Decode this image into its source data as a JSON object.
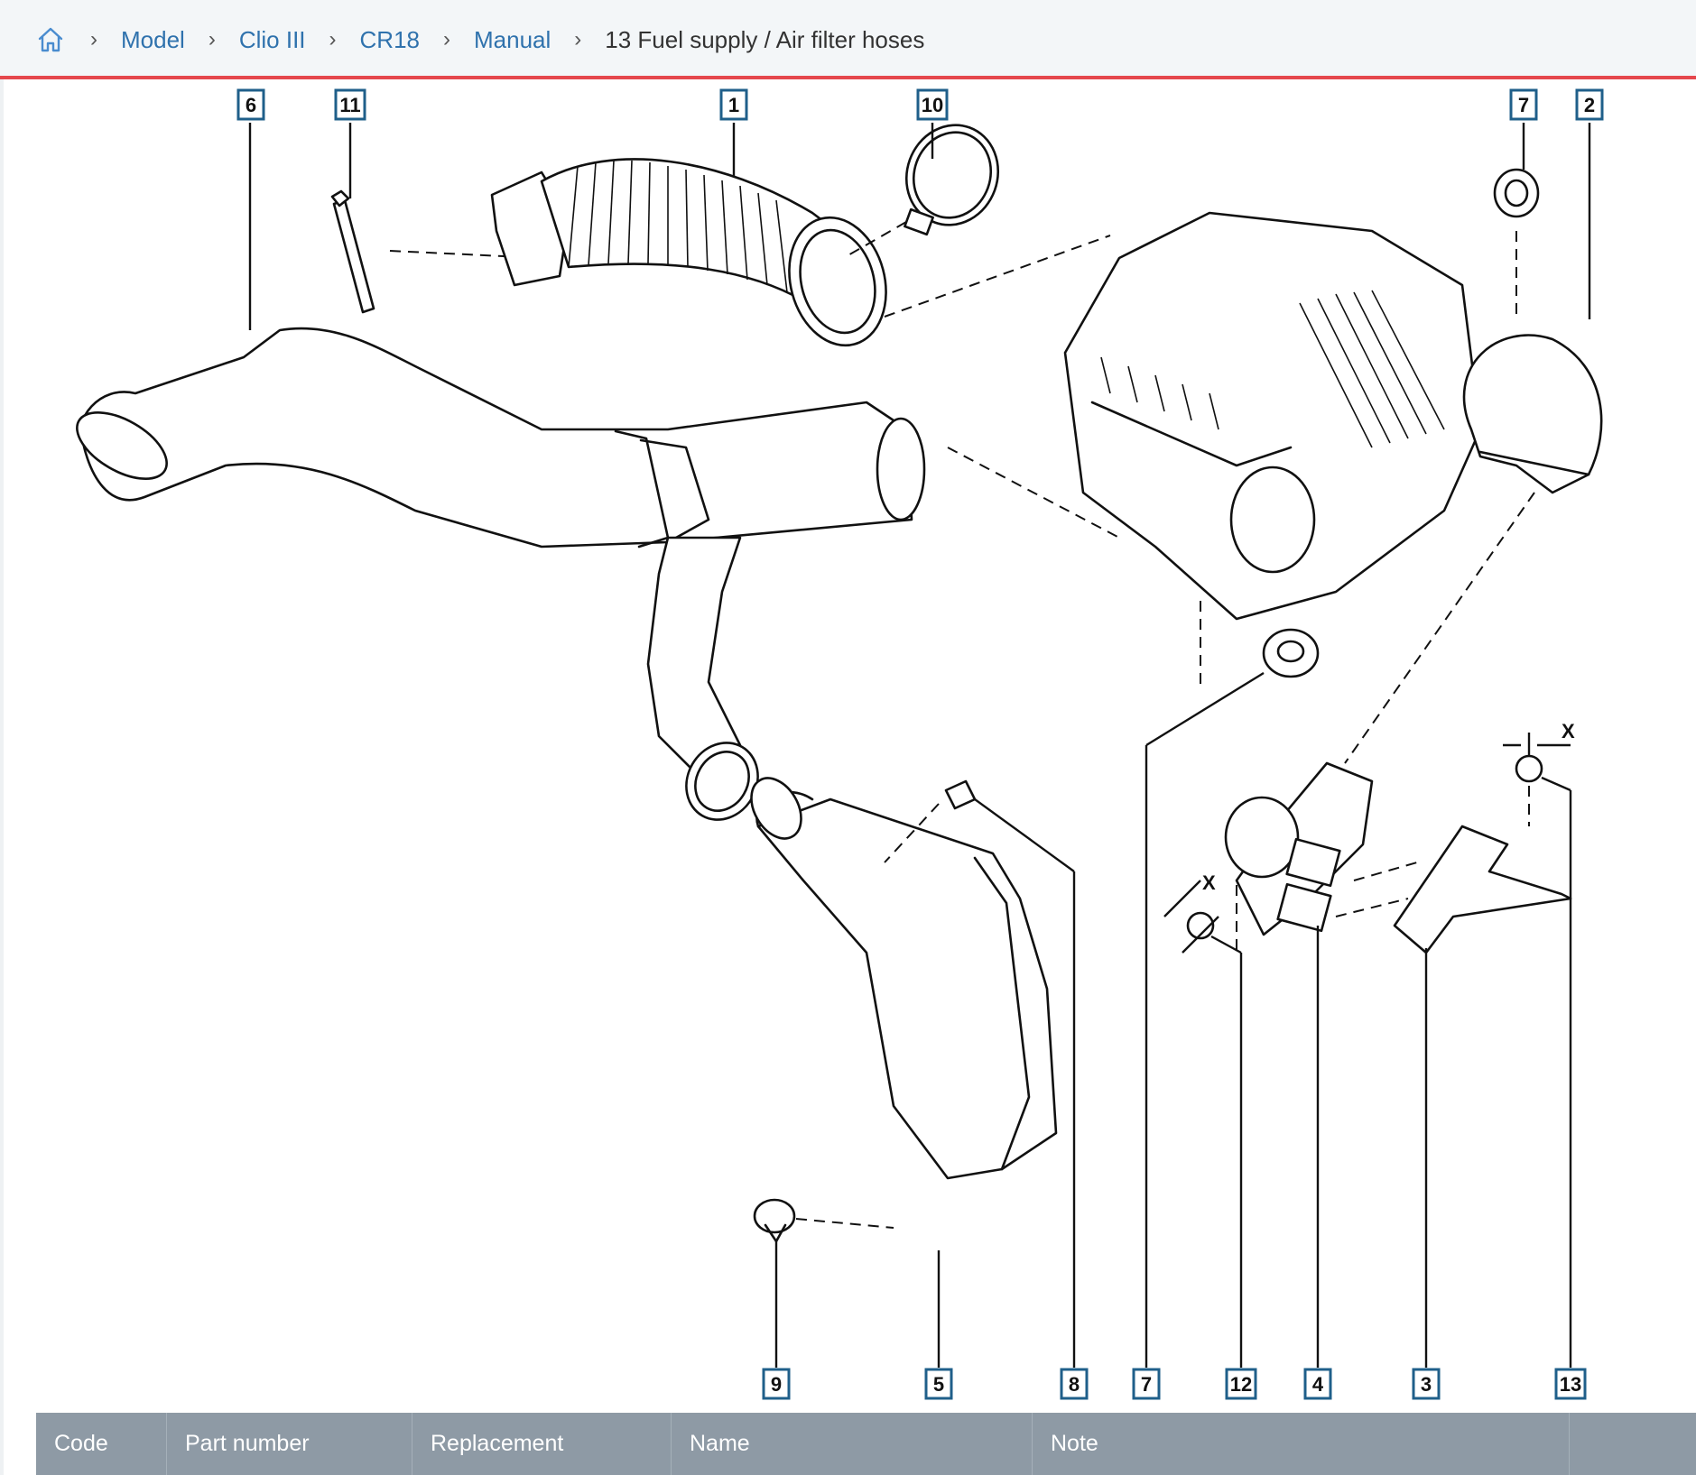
{
  "breadcrumb": {
    "home_icon": "home-icon",
    "items": [
      "Model",
      "Clio III",
      "CR18",
      "Manual"
    ],
    "current": "13 Fuel supply / Air filter hoses"
  },
  "diagram": {
    "callouts": [
      "6",
      "11",
      "1",
      "10",
      "7",
      "2",
      "9",
      "5",
      "8",
      "7",
      "12",
      "4",
      "3",
      "13"
    ],
    "dimension_labels": [
      "X",
      "X"
    ]
  },
  "table": {
    "headers": [
      "Code",
      "Part number",
      "Replacement",
      "Name",
      "Note"
    ]
  },
  "colors": {
    "accent_line": "#e5484d",
    "link": "#2f72ad",
    "table_header": "#8e9aa5"
  }
}
